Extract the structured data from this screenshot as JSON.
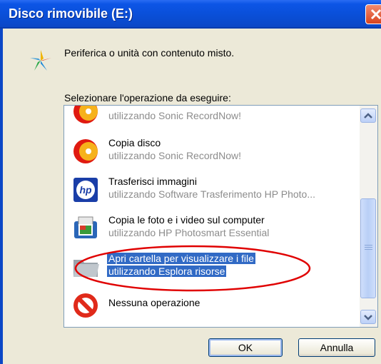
{
  "window": {
    "title": "Disco rimovibile (E:)"
  },
  "header": {
    "description": "Periferica o unità con contenuto misto."
  },
  "prompt": "Selezionare l'operazione da eseguire:",
  "list": {
    "items": [
      {
        "main": "",
        "sub": "utilizzando Sonic RecordNow!",
        "icon": "cd-burn-icon"
      },
      {
        "main": "Copia disco",
        "sub": "utilizzando Sonic RecordNow!",
        "icon": "cd-burn-icon"
      },
      {
        "main": "Trasferisci immagini",
        "sub": "utilizzando Software Trasferimento HP Photo...",
        "icon": "hp-logo-icon"
      },
      {
        "main": "Copia le foto e i video sul computer",
        "sub": "utilizzando HP Photosmart Essential",
        "icon": "photo-printer-icon"
      },
      {
        "main": "Apri cartella per visualizzare i file",
        "sub": "utilizzando Esplora risorse",
        "icon": "folder-icon",
        "selected": true
      },
      {
        "main": "Nessuna operazione",
        "sub": "",
        "icon": "no-entry-icon"
      }
    ]
  },
  "buttons": {
    "ok": "OK",
    "cancel": "Annulla"
  },
  "colors": {
    "selection": "#316ac5",
    "annotation": "#e00000",
    "title_bar": "#0a4fd8"
  }
}
